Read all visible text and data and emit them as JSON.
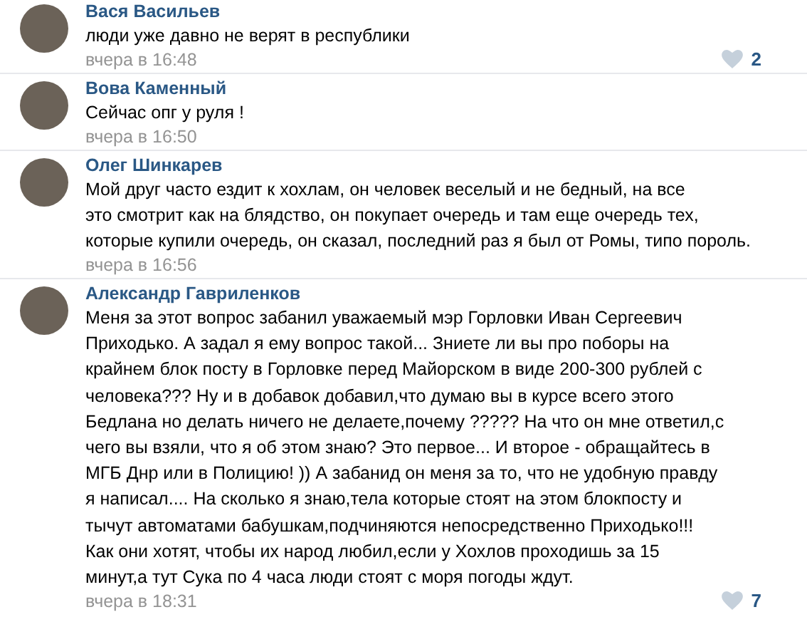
{
  "comments": [
    {
      "author": "Вася Васильев",
      "lines": [
        "люди уже давно не верят в республики"
      ],
      "date": "вчера в 16:48",
      "likes": "2"
    },
    {
      "author": "Вова Каменный",
      "lines": [
        "Сейчас опг у руля !"
      ],
      "date": "вчера в 16:50"
    },
    {
      "author": "Олег Шинкарев",
      "lines": [
        "Мой друг часто ездит к хохлам, он человек веселый и не бедный, на все",
        "это смотрит как на блядство, он покупает очередь и там еще очередь тех,",
        "которые купили очередь, он сказал, последний раз я был от Ромы, типо пороль."
      ],
      "date": "вчера в 16:56"
    },
    {
      "author": "Александр Гавриленков",
      "lines": [
        "Меня за этот вопрос забанил уважаемый мэр Горловки Иван Сергеевич",
        "Приходько. А задал я ему вопрос такой... Зниете ли вы про поборы на",
        "крайнем блок посту в Горловке перед Майорском в виде 200-300 рублей с",
        "человека??? Ну и в добавок добавил,что думаю вы в курсе всего этого",
        "Бедлана но делать ничего не делаете,почему ????? На что он мне ответил,с",
        "чего вы взяли, что я об этом знаю? Это первое... И второе - обращайтесь в",
        "МГБ Днр или в Полицию! )) А забанид он меня за то, что не удобную правду",
        "я написал.... На сколько я знаю,тела которые стоят на этом блокпосту и",
        "тычут автоматами бабушкам,подчиняются непосредственно Приходько!!!",
        "Как они хотят, чтобы их народ любил,если у Хохлов проходишь за 15",
        "минут,а тут Сука по 4 часа люди стоят с моря погоды ждут."
      ],
      "date": "вчера в 18:31",
      "likes": "7"
    }
  ]
}
